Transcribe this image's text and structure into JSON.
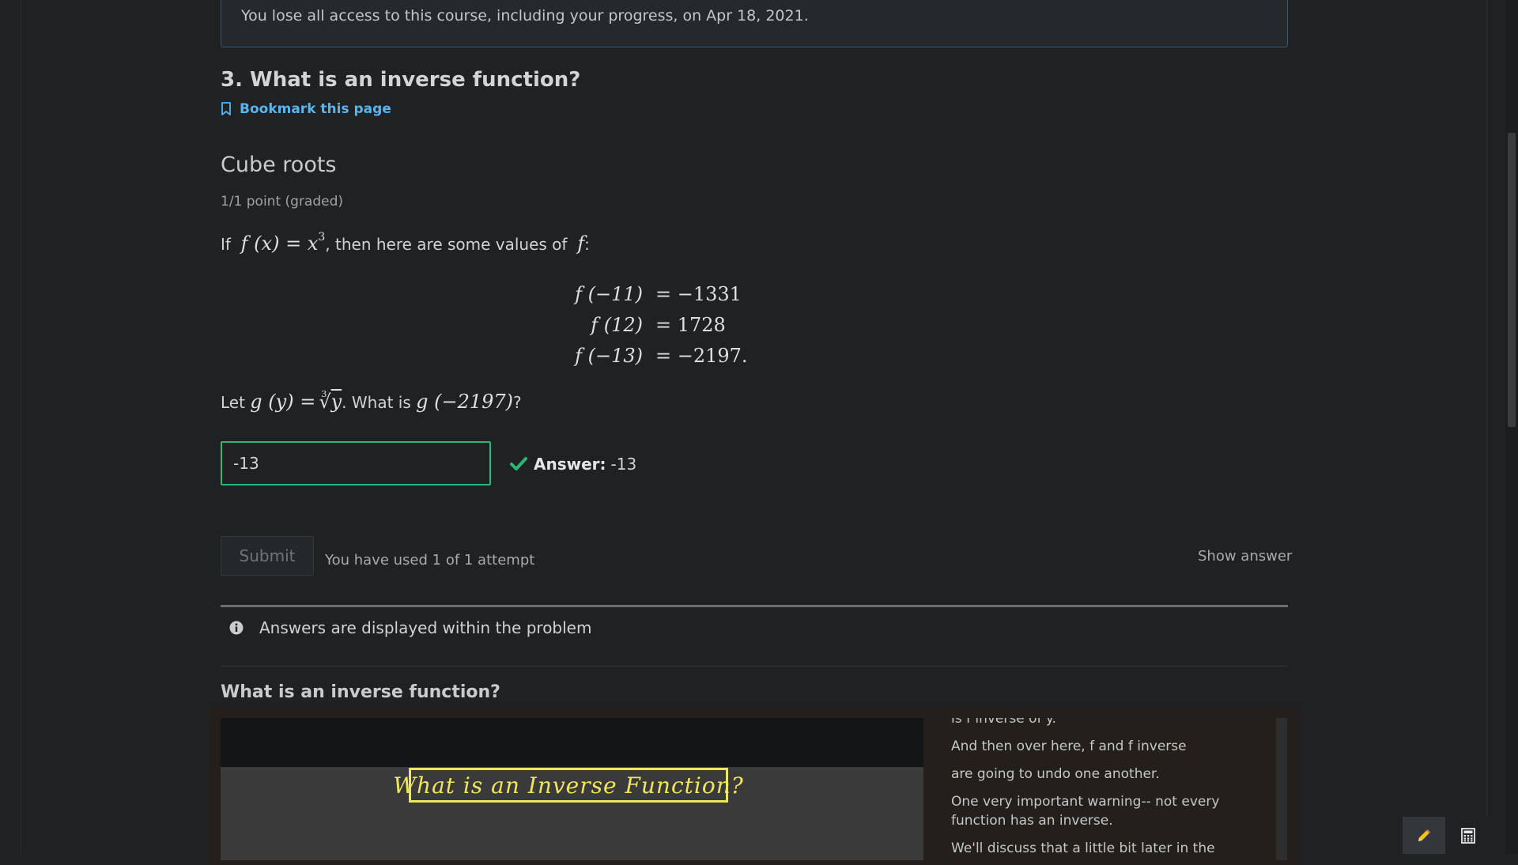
{
  "notice": {
    "text": "You lose all access to this course, including your progress, on Apr 18, 2021."
  },
  "unit": {
    "title": "3. What is an inverse function?",
    "bookmark_label": "Bookmark this page"
  },
  "problem": {
    "title": "Cube roots",
    "progress": "1/1 point (graded)",
    "intro_if": "If",
    "intro_mid": ", then here are some values of",
    "f_def_lhs": "f (x) = x",
    "f_def_exp": "3",
    "f_symbol": "f",
    "values": [
      {
        "lhs": "f (−11)",
        "rhs": "= −1331"
      },
      {
        "lhs": "f (12)",
        "rhs": "= 1728"
      },
      {
        "lhs": "f (−13)",
        "rhs": "= −2197."
      }
    ],
    "question_let": "Let",
    "g_def": "g (y) =",
    "root_index": "3",
    "root_arg": "y",
    "question_what": ". What is",
    "g_query": "g (−2197)",
    "question_end": "?",
    "answer_input_value": "-13",
    "answer_label": "Answer:",
    "answer_value": "-13",
    "submit_label": "Submit",
    "attempts_text": "You have used 1 of 1 attempt",
    "show_answer_label": "Show answer",
    "info_text": "Answers are displayed within the problem"
  },
  "video": {
    "heading": "What is an inverse function?",
    "title_card": "What is an Inverse Function?",
    "transcript": [
      "is f inverse of y.",
      "And then over here, f and f inverse",
      "are going to undo one another.",
      "One very important warning-- not every function has an inverse.",
      "We'll discuss that a little bit later in the"
    ]
  },
  "tools": {
    "notes_icon": "pencil-icon",
    "calculator_icon": "calculator-icon"
  },
  "colors": {
    "accent_link": "#58b5f0",
    "correct": "#2bb673",
    "video_title": "#f0e65c"
  }
}
